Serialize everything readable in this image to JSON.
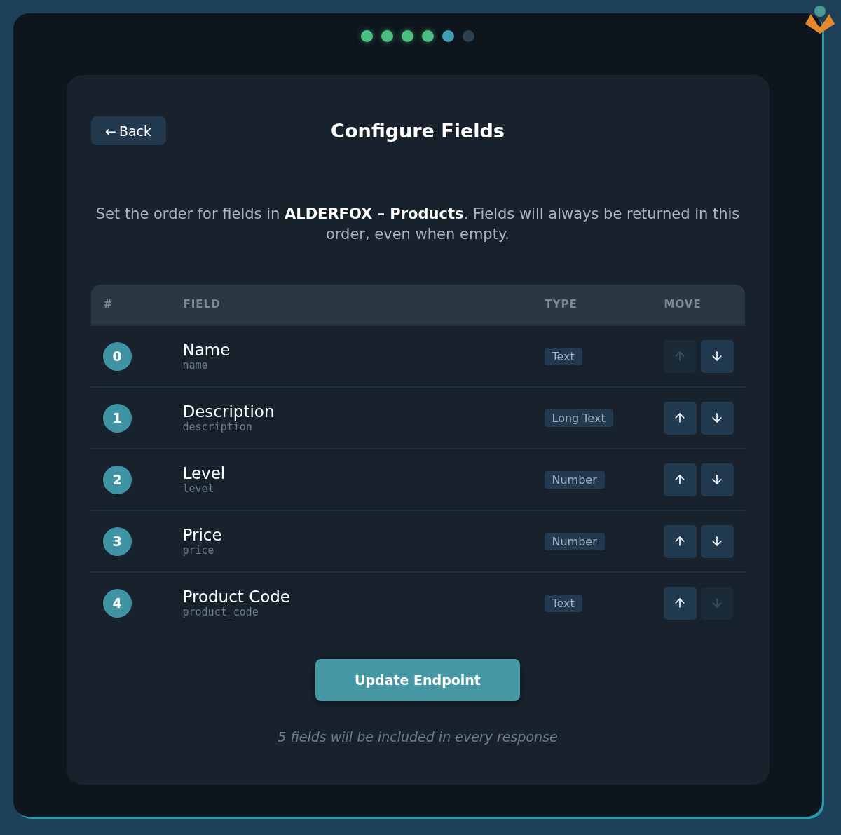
{
  "steps": [
    {
      "done": true,
      "selected": false
    },
    {
      "done": true,
      "selected": false
    },
    {
      "done": true,
      "selected": false
    },
    {
      "done": true,
      "selected": false
    },
    {
      "done": false,
      "selected": true
    },
    {
      "done": false,
      "selected": false
    }
  ],
  "back_button": {
    "arrow": "←",
    "label": "Back"
  },
  "title": "Configure Fields",
  "description": "Set the order for fields in **ALDERFOX – Products**. Fields will always be returned in this order, even when empty.",
  "table": {
    "columns": [
      "#",
      "FIELD",
      "TYPE",
      "MOVE"
    ],
    "rows": [
      {
        "index": "0",
        "name": "Name",
        "key": "name",
        "type": "Text",
        "up_disabled": true,
        "down_disabled": false
      },
      {
        "index": "1",
        "name": "Description",
        "key": "description",
        "type": "Long Text",
        "up_disabled": false,
        "down_disabled": false
      },
      {
        "index": "2",
        "name": "Level",
        "key": "level",
        "type": "Number",
        "up_disabled": false,
        "down_disabled": false
      },
      {
        "index": "3",
        "name": "Price",
        "key": "price",
        "type": "Number",
        "up_disabled": false,
        "down_disabled": false
      },
      {
        "index": "4",
        "name": "Product Code",
        "key": "product_code",
        "type": "Text",
        "up_disabled": false,
        "down_disabled": true
      }
    ]
  },
  "submit_button": "Update Endpoint",
  "footer_note": "5 fields will be included in every response"
}
